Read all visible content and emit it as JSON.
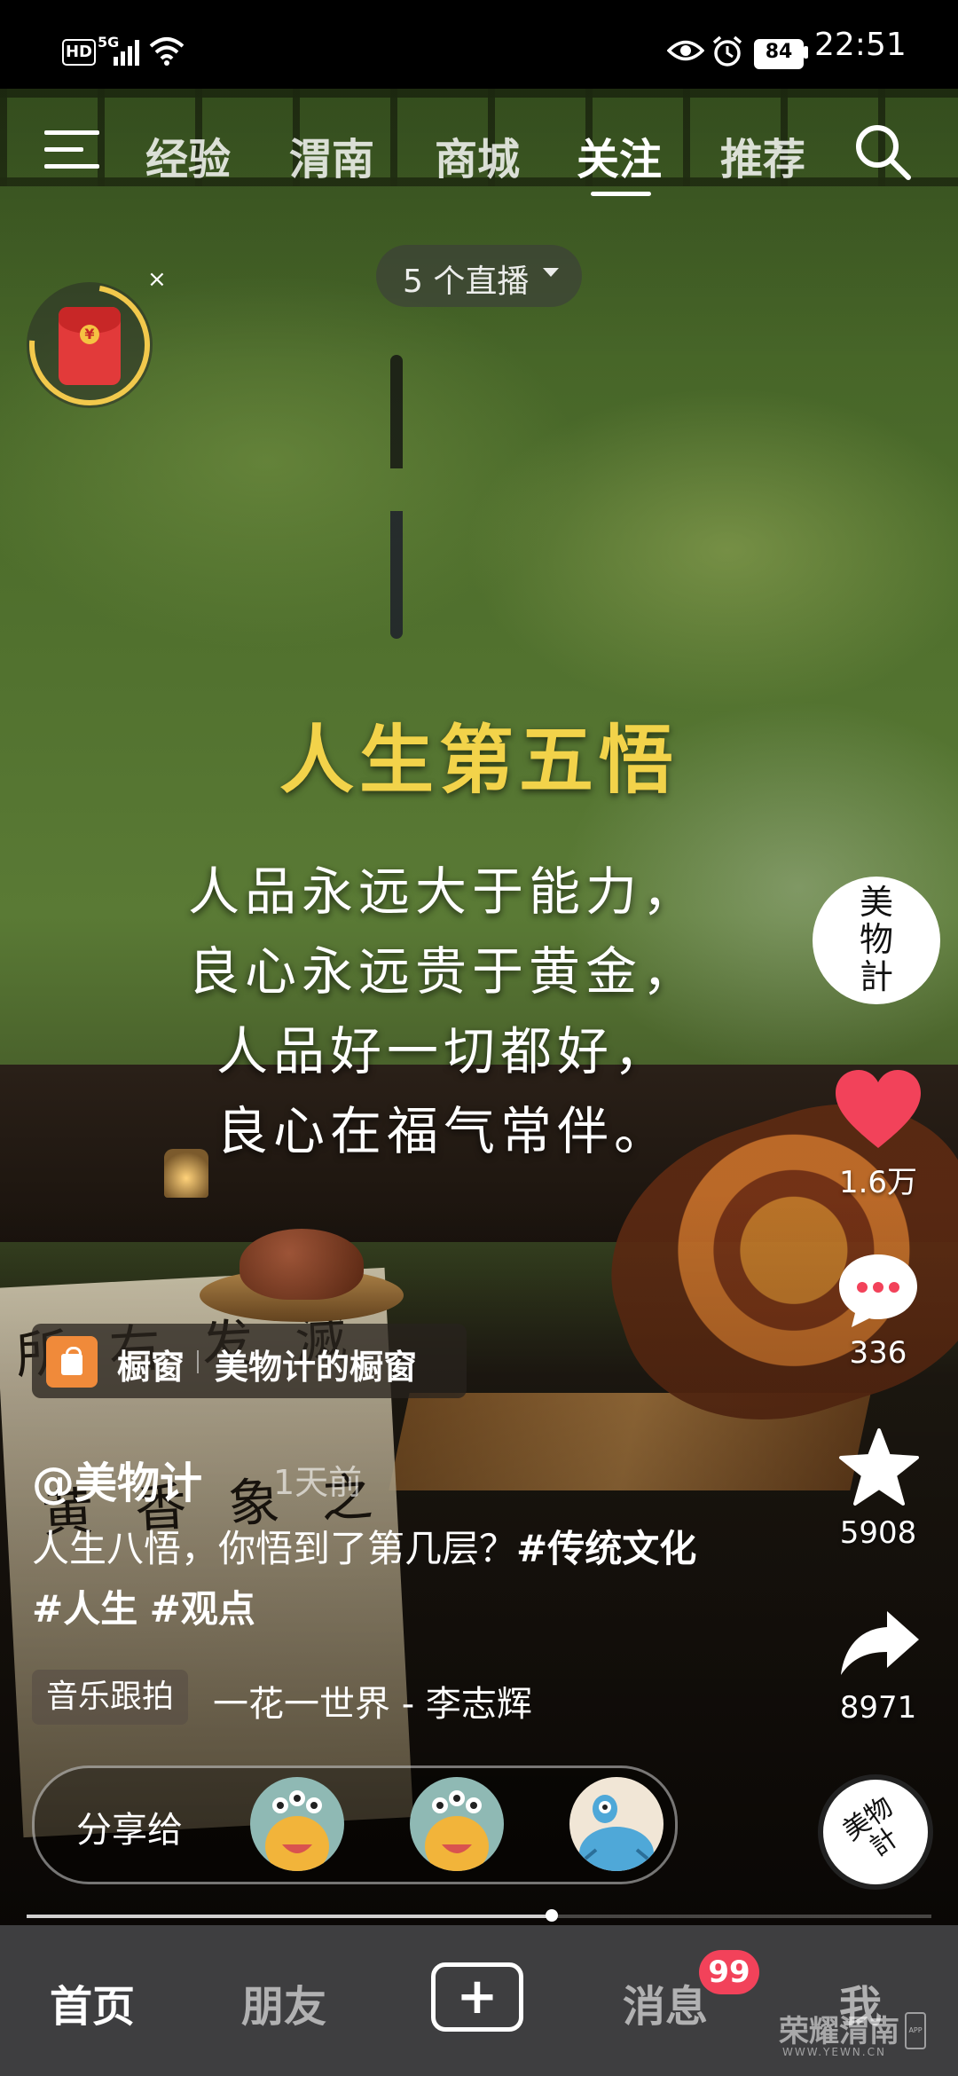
{
  "status_bar": {
    "hd": "HD",
    "signal_type": "5G",
    "battery": "84",
    "time": "22:51",
    "icons": [
      "hd-icon",
      "signal-icon",
      "wifi-icon",
      "eye-icon",
      "alarm-icon",
      "battery-icon"
    ]
  },
  "top_nav": {
    "tabs": [
      {
        "label": "经验",
        "active": false
      },
      {
        "label": "渭南",
        "active": false
      },
      {
        "label": "商城",
        "active": false
      },
      {
        "label": "关注",
        "active": true
      },
      {
        "label": "推荐",
        "active": false
      }
    ],
    "menu_icon": "menu-icon",
    "search_icon": "search-icon"
  },
  "live_pill": {
    "label": "5 个直播"
  },
  "red_packet": {
    "close": "×",
    "symbol": "¥"
  },
  "overlay": {
    "title": "人生第五悟",
    "lines": [
      "人品永远大于能力，",
      "良心永远贵于黄金，",
      "人品好一切都好，",
      "良心在福气常伴。"
    ]
  },
  "scene_calligraphy": [
    "所",
    "右",
    "发",
    "滅",
    "黄",
    "香",
    "象",
    "之"
  ],
  "actions": {
    "author_avatar_text": "美物計",
    "like_count": "1.6万",
    "comment_count": "336",
    "favorite_count": "5908",
    "share_count": "8971",
    "music_disc_text": "美物計"
  },
  "shop": {
    "label": "橱窗",
    "store_name": "美物计的橱窗"
  },
  "post": {
    "author": "@美物计",
    "time": "1天前",
    "text": "人生八悟，你悟到了第几层？",
    "tags": [
      "#传统文化",
      "#人生",
      "#观点"
    ]
  },
  "music": {
    "chip_label": "音乐跟拍",
    "song": "一花一世界 - 李志辉"
  },
  "share": {
    "label": "分享给",
    "targets": [
      "yellow-monster-avatar",
      "yellow-monster-avatar",
      "blue-monster-avatar"
    ]
  },
  "playback": {
    "progress": 0.58
  },
  "tab_bar": {
    "tabs": [
      {
        "label": "首页",
        "active": true
      },
      {
        "label": "朋友",
        "active": false
      },
      {
        "label": "+",
        "active": false
      },
      {
        "label": "消息",
        "active": false
      },
      {
        "label": "我",
        "active": false
      }
    ],
    "message_badge": "99"
  },
  "watermark": {
    "text": "荣耀渭南",
    "sub": "WWW.YEWN.CN",
    "tag": "APP"
  }
}
